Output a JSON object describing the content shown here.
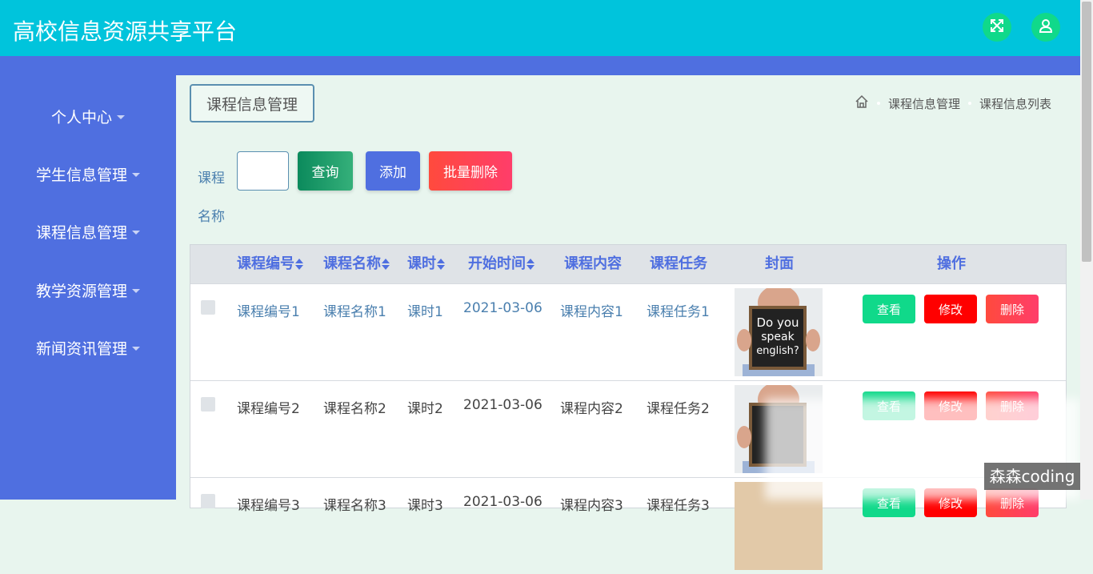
{
  "app": {
    "title": "高校信息资源共享平台"
  },
  "topbar": {
    "fullscreen_icon": "expand-icon",
    "user_icon": "user-icon"
  },
  "sidebar": {
    "items": [
      {
        "label": "个人中心"
      },
      {
        "label": "学生信息管理"
      },
      {
        "label": "课程信息管理"
      },
      {
        "label": "教学资源管理"
      },
      {
        "label": "新闻资讯管理"
      }
    ]
  },
  "page": {
    "tag": "课程信息管理",
    "breadcrumb": {
      "home_icon": "home-icon",
      "level1": "课程信息管理",
      "level2": "课程信息列表"
    }
  },
  "search": {
    "label": "课程名称",
    "value": "",
    "query_label": "查询",
    "add_label": "添加",
    "batch_delete_label": "批量删除"
  },
  "table": {
    "headers": {
      "code": "课程编号",
      "name": "课程名称",
      "hours": "课时",
      "start": "开始时间",
      "content": "课程内容",
      "task": "课程任务",
      "cover": "封面",
      "actions": "操作"
    },
    "rows": [
      {
        "code": "课程编号1",
        "name": "课程名称1",
        "hours": "课时1",
        "start": "2021-03-06",
        "content": "课程内容1",
        "task": "课程任务1"
      },
      {
        "code": "课程编号2",
        "name": "课程名称2",
        "hours": "课时2",
        "start": "2021-03-06",
        "content": "课程内容2",
        "task": "课程任务2"
      },
      {
        "code": "课程编号3",
        "name": "课程名称3",
        "hours": "课时3",
        "start": "2021-03-06",
        "content": "课程内容3",
        "task": "课程任务3"
      }
    ],
    "cover_text": {
      "line1": "Do you",
      "line2": "speak",
      "line3": "english?"
    },
    "actions": {
      "view": "查看",
      "edit": "修改",
      "delete": "删除"
    }
  },
  "watermark": "森森coding",
  "colors": {
    "topbar": "#00c4dc",
    "sidebar": "#4f6fe0",
    "query": "#1a9b6a",
    "add": "#4f6fe0",
    "batch_delete": "#ff3d55",
    "view": "#10d98a",
    "edit": "#ff0000",
    "delete": "#ff4455"
  }
}
